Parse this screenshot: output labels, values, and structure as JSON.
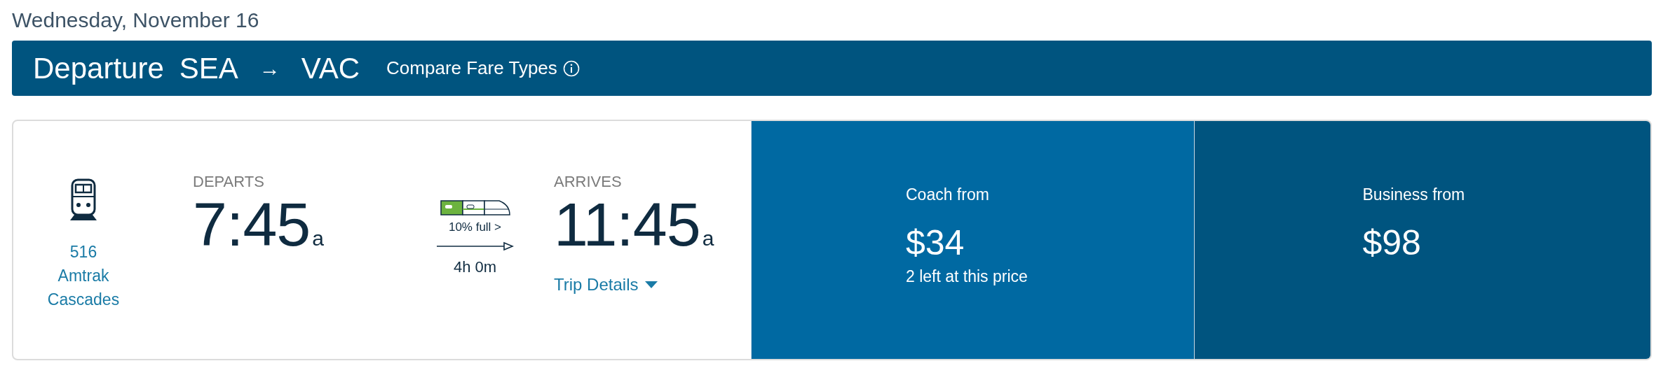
{
  "date": "Wednesday, November 16",
  "header": {
    "title": "Departure",
    "origin": "SEA",
    "arrow": "→",
    "destination": "VAC",
    "compare_link": "Compare Fare Types"
  },
  "trip": {
    "train_number": "516",
    "train_name": "Amtrak Cascades",
    "departs_label": "DEPARTS",
    "departs_time": "7:45",
    "departs_suffix": "a",
    "occupancy": "10% full >",
    "duration": "4h 0m",
    "arrives_label": "ARRIVES",
    "arrives_time": "11:45",
    "arrives_suffix": "a",
    "details_link": {
      "label": "Trip Details",
      "expanded": false
    }
  },
  "fares": [
    {
      "label": "Coach from",
      "price": "$34",
      "note": "2 left at this price",
      "color": "#0069a2"
    },
    {
      "label": "Business from",
      "price": "$98",
      "color": "#00547f"
    }
  ]
}
